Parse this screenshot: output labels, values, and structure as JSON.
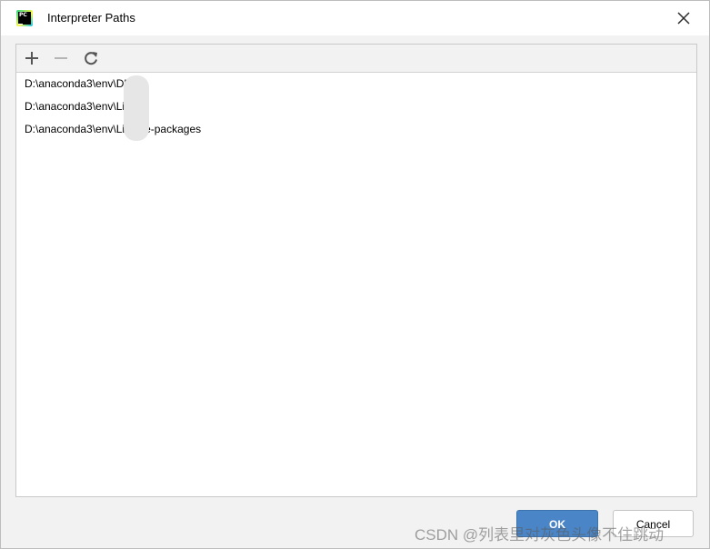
{
  "window": {
    "title": "Interpreter Paths",
    "app_icon_text": "PC"
  },
  "toolbar": {
    "add_icon": "plus-icon",
    "remove_icon": "minus-icon",
    "reload_icon": "refresh-icon"
  },
  "paths": [
    "D:\\anaconda3\\env\\DLLs",
    "D:\\anaconda3\\env\\Lib",
    "D:\\anaconda3\\env\\Lib\\site-packages"
  ],
  "buttons": {
    "ok": "OK",
    "cancel": "Cancel"
  },
  "watermark": "CSDN @列表里对灰色头像不住跳动",
  "colors": {
    "accent": "#4a86c7",
    "background": "#f2f2f2"
  }
}
